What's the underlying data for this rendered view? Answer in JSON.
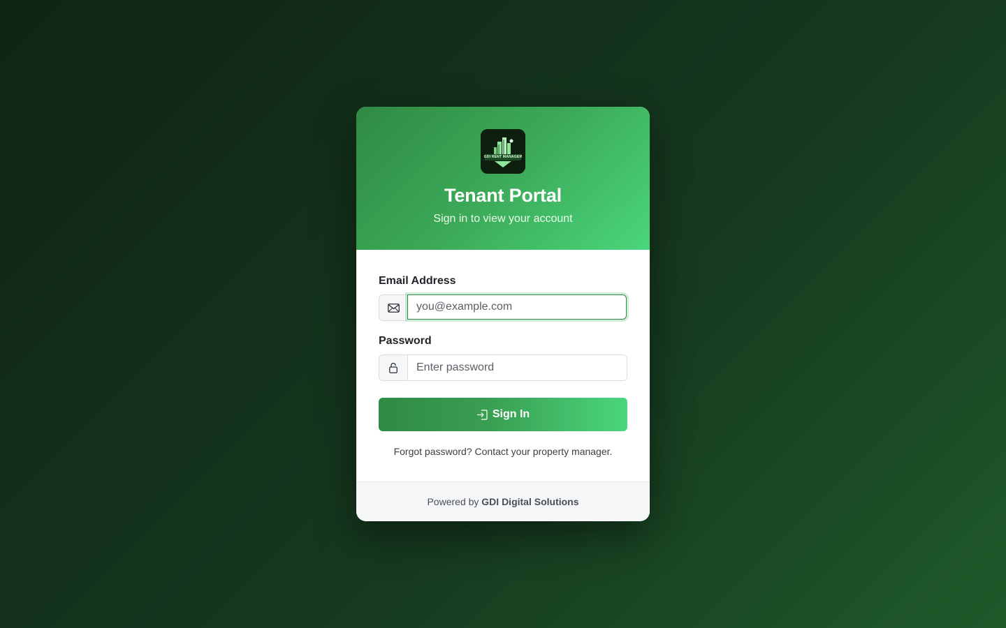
{
  "header": {
    "logo_text": "GDI RENT MANAGER",
    "title": "Tenant Portal",
    "subtitle": "Sign in to view your account"
  },
  "form": {
    "email": {
      "label": "Email Address",
      "placeholder": "you@example.com",
      "icon": "envelope-icon"
    },
    "password": {
      "label": "Password",
      "placeholder": "Enter password",
      "icon": "lock-icon"
    },
    "submit": {
      "label": "Sign In",
      "icon": "sign-in-icon"
    },
    "forgot_text": "Forgot password? Contact your property manager."
  },
  "footer": {
    "prefix": "Powered by",
    "brand": "GDI Digital Solutions"
  },
  "colors": {
    "accent_dark": "#2f8a43",
    "accent_light": "#4ad67c",
    "background": "#163a1f"
  }
}
